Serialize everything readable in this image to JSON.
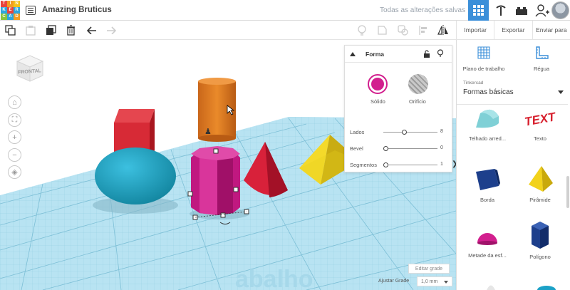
{
  "app": {
    "logo_letters": [
      "TIN",
      "KER",
      "CAD"
    ],
    "design_title": "Amazing Bruticus",
    "save_status": "Todas as alterações salvas"
  },
  "toolbar": {
    "import_label": "Importar",
    "export_label": "Exportar",
    "send_label": "Enviar para"
  },
  "viewcube": {
    "face_label": "FRONTAL"
  },
  "inspector": {
    "title": "Forma",
    "solid_label": "Sólido",
    "hole_label": "Orifício",
    "solid_color": "#d21f8e",
    "params": [
      {
        "label": "Lados",
        "value": "8",
        "fraction": 0.38
      },
      {
        "label": "Bevel",
        "value": "0",
        "fraction": 0.0
      },
      {
        "label": "Segmentos",
        "value": "1",
        "fraction": 0.0
      }
    ]
  },
  "sidebar": {
    "workplane_label": "Plano de trabalho",
    "ruler_label": "Régua",
    "library_source": "Tinkercad",
    "library_name": "Formas básicas",
    "shapes": [
      {
        "label": "Telhado arred...",
        "color": "#7fd0d6"
      },
      {
        "label": "Texto",
        "color": "#d7202e"
      },
      {
        "label": "Borda",
        "color": "#1d3f8c"
      },
      {
        "label": "Pirâmide",
        "color": "#f2d21b"
      },
      {
        "label": "Metade da esf...",
        "color": "#d21f8e"
      },
      {
        "label": "Polígono",
        "color": "#1d3f8c"
      }
    ]
  },
  "footer": {
    "edit_grid_label": "Editar grade",
    "snap_grid_label": "Ajustar Grade",
    "snap_grid_value": "1,0 mm"
  },
  "colors": {
    "accent": "#3b8fd9",
    "workplane": "#b8e3f2",
    "box_red": "#d72a36",
    "cylinder_orange": "#e07b20",
    "prism_magenta": "#d21f8e",
    "cone_red": "#d8213a",
    "pyramid_yellow": "#e9cf1f",
    "sphere_teal": "#1ba1c7"
  }
}
